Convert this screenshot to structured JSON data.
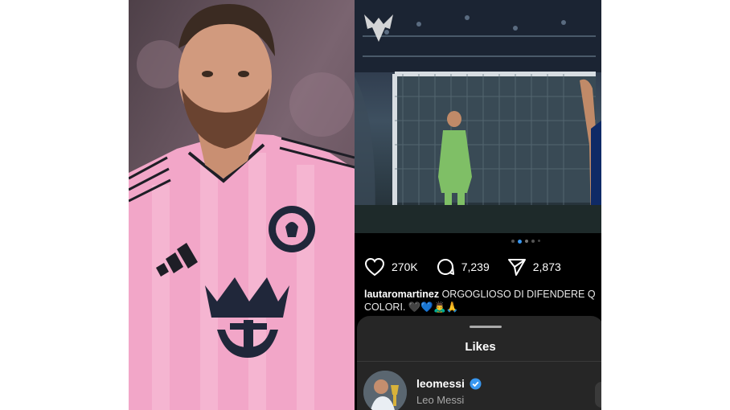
{
  "post": {
    "likes": "270K",
    "comments": "7,239",
    "shares": "2,873",
    "caption_user": "lautaromartinez",
    "caption_text": "ORGOGLIOSO DI DIFENDERE Q",
    "caption_text_2": "COLORI. 🖤💙🙇‍♂️🙏"
  },
  "likes_sheet": {
    "title": "Likes",
    "users": [
      {
        "username": "leomessi",
        "full_name": "Leo Messi",
        "verified": true
      }
    ]
  },
  "colors": {
    "jersey_pink": "#f2a6c8",
    "crest_navy": "#20273a",
    "verified_blue": "#3897f0",
    "sheet_bg": "#262626",
    "keeper_green": "#7fbf66"
  },
  "icons": {
    "like": "heart-icon",
    "comment": "comment-icon",
    "share": "send-icon",
    "verified": "verified-badge-icon"
  }
}
